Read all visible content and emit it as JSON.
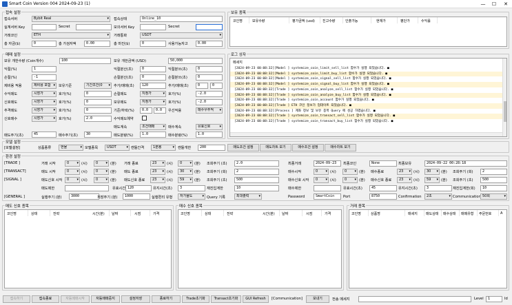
{
  "window": {
    "title": "Smart Coin Version 004 2024-09-23 (1)"
  },
  "settings": {
    "title": "접속 설정",
    "exchange_label": "접속서버",
    "exchange_value": "Bybit Real",
    "server_label": "접속상태",
    "server_value": "Online_10",
    "apikey_label": "실계서버 Key",
    "secret_label": "Secret",
    "sim_label": "모의서버 Key",
    "sim_secret_label": "Secret",
    "coin_label": "거래코인",
    "coin_value": "ETH",
    "currency_label": "거래통화",
    "currency_value": "USDT",
    "total_amt_label": "총 자금($)",
    "total_amt_value": "0",
    "total_cnt_label": "총 가검자액",
    "total_cnt_value": "0.00",
    "margin_label": "총 마진($)",
    "margin_value": "0",
    "avail_label": "사용가능자고",
    "avail_value": "0.00"
  },
  "trade": {
    "title": "매매 설정",
    "holdqty_label": "보유 개한수량 (Coin개수)",
    "holdqty_value": "100",
    "holdamt_label": "보유 개한금액 (USD)",
    "holdamt_value": "50,000",
    "profit_label": "익절(%)",
    "profit_value": "1",
    "profit_tick_label": "익절분산(초)",
    "profit_tick_value": "0",
    "profit_cnt_label": "익절분쓰(초)",
    "profit_cnt_value": "0",
    "loss_label": "손절(%)",
    "loss_value": "-1",
    "loss_tick_label": "손절분산(초)",
    "loss_tick_value": "0",
    "loss_cnt_label": "손절분쓰(초)",
    "loss_cnt_value": "0",
    "reentry_label": "제비용 적용",
    "reentry_value": "제비용 포함",
    "hold_tick_label": "보유기준",
    "hold_tick_value": "기간조건(0",
    "extra_label": "추가/매매(초)",
    "extra_value": "120",
    "extra2_label": "추가/매매(초)",
    "extra2_value": "0",
    "extra3_value": "0",
    "buy_label": "수익매도",
    "buy_value": "시장가",
    "buy_rate_label": "호가(%)",
    "buy_rate_value": "0",
    "pl_label": "손절매도",
    "pl_value": "지정가",
    "pl_rate_label": "호가(%)",
    "pl_rate_value": "-2.0",
    "sig_label": "신호매도",
    "sig_value": "시장가",
    "sig_rate_label": "호가(%)",
    "sig_rate_value": "0",
    "hold_label": "보유매도",
    "hold_value": "지정가",
    "hold_rate_label": "호가(%)",
    "hold_rate_value": "-2.0",
    "add_label": "추격매도",
    "add_value": "시장가",
    "add_rate_label": "호가(%)",
    "add_rate_value": "0",
    "base_label": "기준/하락(%)",
    "base_value": "0.0",
    "base2_value": "0.0",
    "prio_label": "우선적용",
    "prio_value": "매수우추적",
    "sigbuy_label": "신호매수",
    "sigbuy_value": "시장가",
    "sigbuy_rate_label": "호가(%)",
    "sigbuy_rate_value": "2.0",
    "profit_exec_label": "수익매도예약",
    "sell_method_label": "매도계속",
    "sell_method_value": "조건매매",
    "buy_method_label": "매수계속",
    "buy_method_value": "유효신호",
    "cycle_sell_label": "매도주기(초)",
    "cycle_sell_value": "45",
    "cycle_buy_label": "매수주기(초)",
    "cycle_buy_value": "30",
    "cycle_qty_label": "매도분량(%)",
    "cycle_qty_value": "1.0",
    "cycle_qty2_label": "매수분량(%)",
    "cycle_qty2_value": "1.0"
  },
  "model": {
    "title": "모델 설정",
    "sub_label": "[모델설정]",
    "kind_label": "상품종류",
    "kind_value": "현물",
    "coin_label": "모델종목",
    "coin_value": "USDT",
    "interval_label": "캔들간격",
    "interval_value": "1분봉",
    "count_label": "캔들개한",
    "count_value": "200",
    "btn_buy_cond": "매도조건 설정",
    "btn_buy_chart": "매도차트 보기",
    "btn_sell_cond": "매수조건 설정",
    "btn_sell_chart": "매수차트 보기"
  },
  "env": {
    "title": "환경 설정",
    "trade_tag": "[TRADE    ]",
    "transact_tag": "[TRANSACT]",
    "signal_tag": "[SIGNAL  ]",
    "general_tag": "[GENERAL ]",
    "trade_start_label": "거래 시작",
    "trade_end_label": "거래 종료",
    "sell_start_label": "매도 시작",
    "sell_end_label": "매도 종료",
    "sig_start_label": "매도신호 시작",
    "sig_end_label": "매도신호 종료",
    "h0": "0",
    "m0": "0",
    "h23": "23",
    "m59": "59",
    "h30": "30",
    "unit_h": "(시)",
    "unit_m": "(분)",
    "period_label": "조회주기 (초)",
    "period_value": "2.0",
    "count_label": "조회주기 (회)",
    "count_value": "2",
    "sig_period_label": "조회주기 (초)",
    "sig_period_value": "500",
    "cond_label": "매도제한",
    "cond_value": "",
    "unit_time_label": "유효시간(초)",
    "unit_time_value": "120",
    "lock_label": "유지시간(초)",
    "lock_value": "3",
    "retry_label": "재진입계한",
    "retry_value": "10",
    "sim_exec_label": "실행주기 (분)",
    "sim_exec_value": "3000",
    "max_exec_label": "저장주기 (분)",
    "max_exec_value": "1000",
    "conn_label": "실행편리 유형",
    "conn_value": "처가율도",
    "query_label": "Query 기록",
    "query_value": "최대출력",
    "start_date_label": "최종거래",
    "start_date_value": "2024-09-23",
    "last_coin_label": "최종코인",
    "last_coin_value": "None",
    "last_time_label": "최종보유",
    "last_time_value": "2024-09-22 00:28:18",
    "r_buy_start_label": "매수시작",
    "r_buy_end_label": "매수종료",
    "r_sig_start_label": "매수신호 시작",
    "r_sig_end_label": "매수신호 종료",
    "r_period_label": "조회주기 (회)",
    "r_period_value": "2",
    "r_sig_period_label": "조회주기 (초)",
    "r_sig_period_value": "500",
    "r_cond_label": "매수제한",
    "r_unit_label": "유효시간(초)",
    "r_unit_value": "45",
    "r_lock_label": "유지시간(초)",
    "r_lock_value": "3",
    "r_retry_label": "재진입계한(회)",
    "r_retry_value": "10",
    "password_label": "Password",
    "password_value": "SmartCoin",
    "port_label": "Port",
    "port_value": "8750",
    "confirm_label": "Confirmation",
    "confirm_value": "2초",
    "comm_label": "Communication",
    "comm_value": "50회"
  },
  "holdings": {
    "title": "보유 종목",
    "columns": [
      "코인명",
      "보유수량",
      "평가금액 (usd)",
      "진고수량",
      "인출가능",
      "현재가",
      "평단가",
      "수익률"
    ]
  },
  "log": {
    "title": "로그 상자",
    "col": "메세지",
    "lines": [
      "[2024-09-23 00:08:32][Model    ] systemize_coin_limit_sell_list 함수가 실행 되었습니다. ■",
      "[2024-09-23 00:08:32][Model    ] systemize_coin_limit_buy_list 함수가 실행 되었습니다. ■",
      "[2024-09-23 00:08:32][Model    ] systemize_coin_signal_sell_list 함수가 실행 되었습니다. ■",
      "[2024-09-23 00:08:32][Model    ] systemize_coin_signal_buy_list 함수가 실행 되었습니다. ■",
      "[2024-09-23 00:08:32][Trade    ] systemize_coin_analyze_sell_list 함수가 실행 되었습니다. ■",
      "[2024-09-23 00:08:32][Trade    ] systemize_coin_analyze_buy_list 함수가 실행 되었습니다. ■",
      "[2024-09-23 00:08:32][Trade    ] systemize_coin_account 함수가 실행 되었습니다. ■",
      "[2024-09-23 00:08:32][Trade    ] ETH 코인 정보가 업데이트 되었습니다. ■",
      "[2024-09-23 00:08:32][Process  ] 계좌 정보 및 보유 종목 Query 에 성공 하였습니다. ■",
      "[2024-09-23 00:08:32][Trade    ] systemize_coin_transact_sell_list 함수가 실행 되었습니다. ■",
      "[2024-09-23 00:08:32][Trade    ] systemize_coin_transact_buy_list 함수가 실행 되었습니다. ■"
    ]
  },
  "sellsig": {
    "title": "매도 신호 종목",
    "columns": [
      "코인명",
      "상태",
      "전략",
      "시간(분)",
      "날짜",
      "시점",
      "가격"
    ]
  },
  "buysig": {
    "title": "매수 신호 종목",
    "columns": [
      "코인명",
      "상태",
      "전략",
      "시간(분)",
      "날짜",
      "시점",
      "가격"
    ]
  },
  "orders": {
    "title": "거래 종목",
    "columns": [
      "코인명",
      "상품명",
      "매세지",
      "매도상태",
      "매수상태",
      "매매유형",
      "주문번호",
      "A"
    ]
  },
  "toolbar": {
    "b1": "접속하기",
    "b2": "접속종료",
    "b3": "자동매매시작",
    "b4": "자동매매중지",
    "b5": "설정저장",
    "b6": "종료하기",
    "b7": "Trade초기화",
    "b8": "Transact초기화",
    "b9": "GUI Refresh",
    "comm_tag": "[Communication]",
    "b10": "보내기",
    "msg_label": "전송 메세지",
    "level_label": "Level",
    "level_value": "1",
    "id_label": "Id"
  },
  "colors": {
    "log_alt": "#fff5d6",
    "accent": "#1e5fbf"
  }
}
